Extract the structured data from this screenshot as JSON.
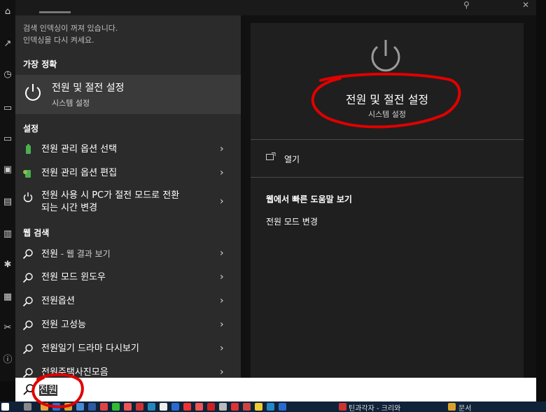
{
  "left_panel": {
    "notice_line1": "검색 인덱싱이 꺼져 있습니다.",
    "notice_line2": "인덱싱을 다시 켜세요.",
    "best_match_header": "가장 정확",
    "best_match": {
      "title": "전원 및 절전 설정",
      "subtitle": "시스템 설정"
    },
    "settings_header": "설정",
    "settings_items": [
      {
        "label": "전원 관리 옵션 선택"
      },
      {
        "label": "전원 관리 옵션 편집"
      },
      {
        "label_line1": "전원 사용 시 PC가 절전 모드로 전환",
        "label_line2": "되는 시간 변경"
      }
    ],
    "web_header": "웹 검색",
    "web_items": [
      {
        "label": "전원",
        "suffix": " - 웹 결과 보기"
      },
      {
        "label": "전원 모드 윈도우"
      },
      {
        "label": "전원옵션"
      },
      {
        "label": "전원 고성능"
      },
      {
        "label": "전원일기 드라마 다시보기"
      },
      {
        "label": "전원주택사진모음"
      }
    ]
  },
  "right_panel": {
    "title": "전원 및 절전 설정",
    "subtitle": "시스템 설정",
    "open_label": "열기",
    "web_help_header": "웹에서 빠른 도움말 보기",
    "web_help_item": "전원 모드 변경"
  },
  "search": {
    "query": "전원"
  },
  "taskbar": {
    "item1": "틴과각자 - 크리와",
    "item2": "문서"
  },
  "colors": {
    "annotation": "#e00000",
    "panel": "#2b2b2b",
    "selected": "#3a3a3a"
  }
}
